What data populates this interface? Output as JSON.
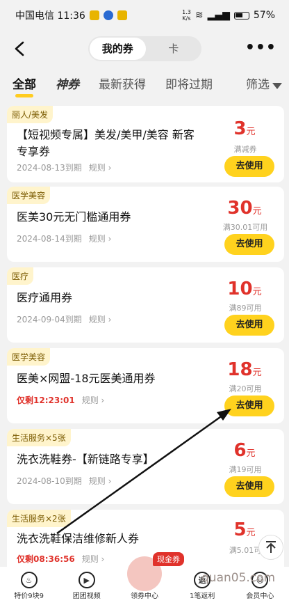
{
  "status_bar": {
    "carrier_time": "中国电信 11:36",
    "net_speed_top": "1.3",
    "net_speed_bottom": "K/s",
    "battery": "57%"
  },
  "header": {
    "back_icon": "chevron-left-icon",
    "segments": [
      "我的券",
      "卡"
    ],
    "more_icon": "more-dots-icon"
  },
  "tabs": [
    "全部",
    "神券",
    "最新获得",
    "即将过期",
    "筛选"
  ],
  "coupons": [
    {
      "tag": "丽人/美发",
      "title": "【短视频专属】美发/美甲/美容 新客专享券",
      "expiry": "2024-08-13到期",
      "rule": "规则",
      "amount": "3",
      "unit": "元",
      "condition": "满减券",
      "button": "去使用"
    },
    {
      "tag": "医学美容",
      "title": "医美30元无门槛通用券",
      "expiry": "2024-08-14到期",
      "rule": "规则",
      "amount": "30",
      "unit": "元",
      "condition": "满30.01可用",
      "button": "去使用"
    },
    {
      "tag": "医疗",
      "title": "医疗通用券",
      "expiry": "2024-09-04到期",
      "rule": "规则",
      "amount": "10",
      "unit": "元",
      "condition": "满89可用",
      "button": "去使用"
    },
    {
      "tag": "医学美容",
      "title": "医美×网盟-18元医美通用券",
      "countdown": "仅剩12:23:01",
      "rule": "规则",
      "amount": "18",
      "unit": "元",
      "condition": "满20可用",
      "button": "去使用"
    },
    {
      "tag": "生活服务×5张",
      "title": "洗衣洗鞋券-【新链路专享】",
      "expiry": "2024-08-10到期",
      "rule": "规则",
      "amount": "6",
      "unit": "元",
      "condition": "满19可用",
      "button": "去使用"
    },
    {
      "tag": "生活服务×2张",
      "title": "洗衣洗鞋保洁维修新人券",
      "countdown": "仅剩08:36:56",
      "rule": "规则",
      "amount": "5",
      "unit": "元",
      "condition": "满5.01可"
    }
  ],
  "bottom_nav": {
    "items": [
      {
        "label": "特价9块9",
        "icon": "flame-icon"
      },
      {
        "label": "团团视频",
        "icon": "play-icon"
      },
      {
        "label": "领券中心",
        "icon": "coupon-center-icon"
      },
      {
        "label": "1笔返利",
        "icon": "rebate-icon",
        "glyph": "返"
      },
      {
        "label": "会员中心",
        "icon": "member-icon"
      }
    ],
    "cash_badge": "现金券"
  },
  "watermark": "quan05.com",
  "colors": {
    "accent_yellow": "#ffd21e",
    "price_red": "#e0322b",
    "tag_bg": "#fff4cc"
  }
}
